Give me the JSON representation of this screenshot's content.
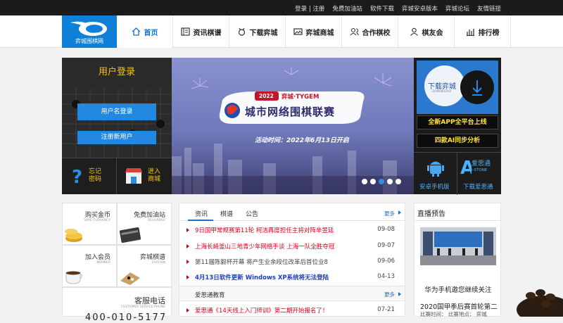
{
  "topbar": {
    "links": [
      "登录 | 注册",
      "免费加油站",
      "软件下载",
      "弈城安卓版本",
      "弈城论坛",
      "友情链接"
    ]
  },
  "logo": {
    "text": "弈城围棋网"
  },
  "nav": {
    "items": [
      {
        "label": "首页",
        "icon": "home-icon"
      },
      {
        "label": "资讯棋谱",
        "icon": "book-icon"
      },
      {
        "label": "下载弈城",
        "icon": "medal-icon"
      },
      {
        "label": "弈城商城",
        "icon": "image-icon"
      },
      {
        "label": "合作棋校",
        "icon": "users-icon"
      },
      {
        "label": "棋友会",
        "icon": "user-icon"
      },
      {
        "label": "排行榜",
        "icon": "bars-icon"
      }
    ]
  },
  "login": {
    "title": "用户登录",
    "username_login": "用户名登录",
    "register": "注册新用户",
    "forgot": "忘记密码",
    "shop": "进入商城"
  },
  "banner": {
    "year": "2022",
    "brand": "弈城·TYGEM",
    "headline": "城市网络围棋联赛",
    "time": "活动时间：2022年6月13日开启",
    "dots": 4,
    "active_dot": 3
  },
  "right_panel": {
    "download": "下载弈城",
    "download_sub": "DOWNLOAD",
    "app": "全新APP全平台上线",
    "ai": "四款AI同步分析",
    "android": "安卓手机版",
    "aisitong": "下载爱思通",
    "aisitong_logo": "爱思通",
    "aisitong_sub": "i-STONE"
  },
  "services": {
    "cells": [
      {
        "title": "购买金币",
        "sub": "SAVE CURRENCY"
      },
      {
        "title": "免费加油站",
        "sub": "RECHARGE"
      },
      {
        "title": "加入会员",
        "sub": "MEMBER"
      },
      {
        "title": "弈城棋谱",
        "sub": "EXPLAIN"
      }
    ],
    "phone_title": "客服电话",
    "phone_sub": "CUSTOMER SERVICE PHONE",
    "phone_number": "400-010-5177"
  },
  "news": {
    "tabs": [
      "资讯",
      "棋谱",
      "公告"
    ],
    "more": "更多",
    "items": [
      {
        "title": "9日国甲常规赛第11轮 柯洁再度担任主将对阵辛昱廷",
        "date": "09-08",
        "style": "red"
      },
      {
        "title": "上海长崎釜山三地青少年网络手谈 上海一队全胜夺冠",
        "date": "09-07",
        "style": "red"
      },
      {
        "title": "第11届陈毅杯开幕 将产生业余段位改革后首位业8",
        "date": "09-06",
        "style": "normal"
      },
      {
        "title": "4月13日软件更新 Windows XP系统将无法登陆",
        "date": "04-13",
        "style": "blue"
      }
    ],
    "section2": "爱思通教育",
    "section2_more": "更多",
    "items2": [
      {
        "title": "爱思通《14天线上入门师训》第二期开始报名了！",
        "date": "07-21",
        "style": "red"
      }
    ]
  },
  "live": {
    "title": "直播预告",
    "caption": "华为手机邀您继续关注",
    "event": "2020国甲季后赛首轮第二",
    "row": "比赛时间：   比赛地点：   弈城"
  },
  "colors": {
    "brand_blue": "#0f80d7",
    "button_blue": "#2389e0",
    "gold": "#f5c518",
    "news_red": "#d4001a",
    "news_blue": "#1a3dbd"
  }
}
